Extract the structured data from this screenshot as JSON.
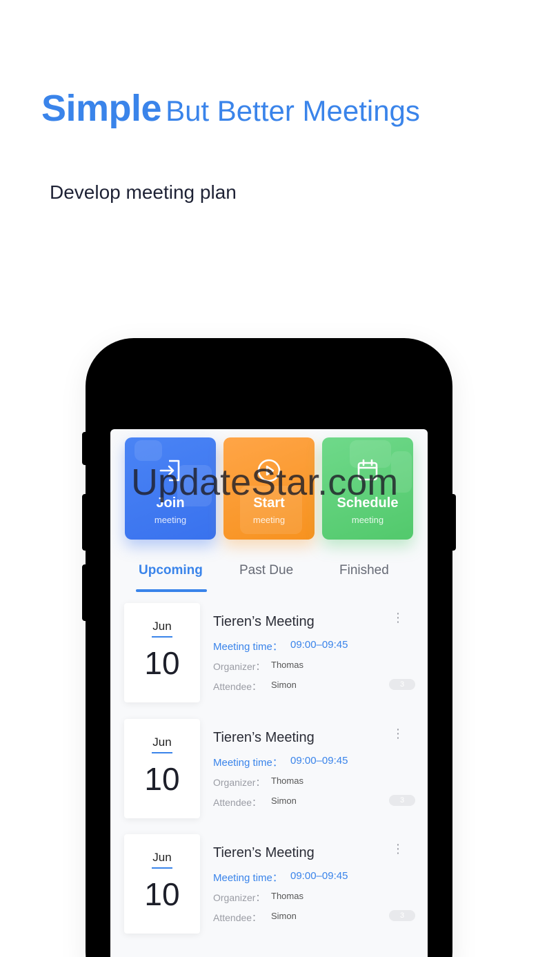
{
  "headline": {
    "bold": "Simple",
    "rest": "But Better Meetings"
  },
  "subline": "Develop meeting plan",
  "accent_color": "#3a84ea",
  "actions": [
    {
      "label": "Join",
      "sub": "meeting",
      "icon": "join-arrow-icon",
      "color": "#3972ee"
    },
    {
      "label": "Start",
      "sub": "meeting",
      "icon": "play-circle-icon",
      "color": "#f7921f"
    },
    {
      "label": "Schedule",
      "sub": "meeting",
      "icon": "calendar-icon",
      "color": "#52c96c"
    }
  ],
  "tabs": [
    {
      "label": "Upcoming",
      "active": true
    },
    {
      "label": "Past Due",
      "active": false
    },
    {
      "label": "Finished",
      "active": false
    }
  ],
  "meetings": [
    {
      "month": "Jun",
      "day": "10",
      "title": "Tieren’s Meeting",
      "time_label": "Meeting time：",
      "time": "09:00–09:45",
      "organizer_label": "Organizer：",
      "organizer": "Thomas",
      "attendee_label": "Attendee：",
      "attendee": "Simon",
      "count": "3"
    },
    {
      "month": "Jun",
      "day": "10",
      "title": "Tieren’s Meeting",
      "time_label": "Meeting time：",
      "time": "09:00–09:45",
      "organizer_label": "Organizer：",
      "organizer": "Thomas",
      "attendee_label": "Attendee：",
      "attendee": "Simon",
      "count": "3"
    },
    {
      "month": "Jun",
      "day": "10",
      "title": "Tieren’s Meeting",
      "time_label": "Meeting time：",
      "time": "09:00–09:45",
      "organizer_label": "Organizer：",
      "organizer": "Thomas",
      "attendee_label": "Attendee：",
      "attendee": "Simon",
      "count": "3"
    }
  ],
  "watermark": "UpdateStar.com"
}
